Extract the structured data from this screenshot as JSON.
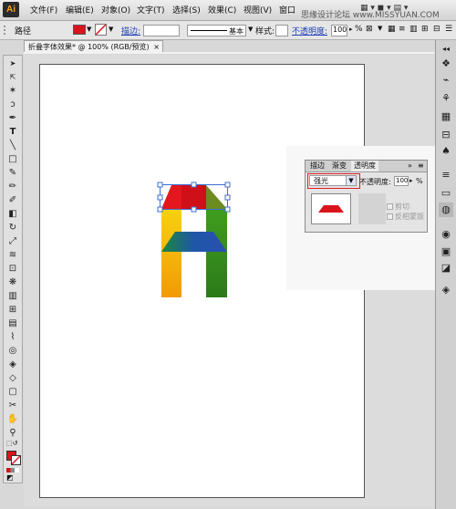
{
  "menubar": {
    "logo": "Ai",
    "items": [
      "文件(F)",
      "编辑(E)",
      "对象(O)",
      "文字(T)",
      "选择(S)",
      "效果(C)",
      "视图(V)",
      "窗口"
    ],
    "watermark": "思缘设计论坛 www.MISSYUAN.COM"
  },
  "control_bar": {
    "object_type": "路径",
    "fill_color": "#d9141c",
    "stroke_label": "描边:",
    "stroke_line_label": "基本",
    "style_label": "样式:",
    "opacity_label": "不透明度:",
    "opacity_value": "100",
    "percent": "%"
  },
  "document_tab": {
    "title": "折叠字体效果* @ 100% (RGB/预览)",
    "close": "×"
  },
  "transparency_panel": {
    "tabs": [
      "描边",
      "渐变",
      "透明度"
    ],
    "active_tab": "透明度",
    "blend_mode": "强光",
    "opacity_label": "不透明度:",
    "opacity_value": "100",
    "percent": "%",
    "clip_label": "剪切",
    "invert_mask_label": "反相蒙版"
  },
  "toolbar": {
    "tools": [
      "selection-tool",
      "direct-selection-tool",
      "magic-wand-tool",
      "lasso-tool",
      "pen-tool",
      "type-tool",
      "line-tool",
      "rectangle-tool",
      "paintbrush-tool",
      "pencil-tool",
      "blob-brush-tool",
      "eraser-tool",
      "rotate-tool",
      "scale-tool",
      "warp-tool",
      "free-transform-tool",
      "symbol-sprayer-tool",
      "column-graph-tool",
      "mesh-tool",
      "gradient-tool",
      "eyedropper-tool",
      "blend-tool",
      "live-paint-bucket-tool",
      "live-paint-selection-tool",
      "artboard-tool",
      "slice-tool",
      "hand-tool",
      "zoom-tool"
    ]
  },
  "colors": {
    "fill": "#d9141c",
    "highlight": "#e0202a",
    "selection": "#3a6fd8"
  }
}
